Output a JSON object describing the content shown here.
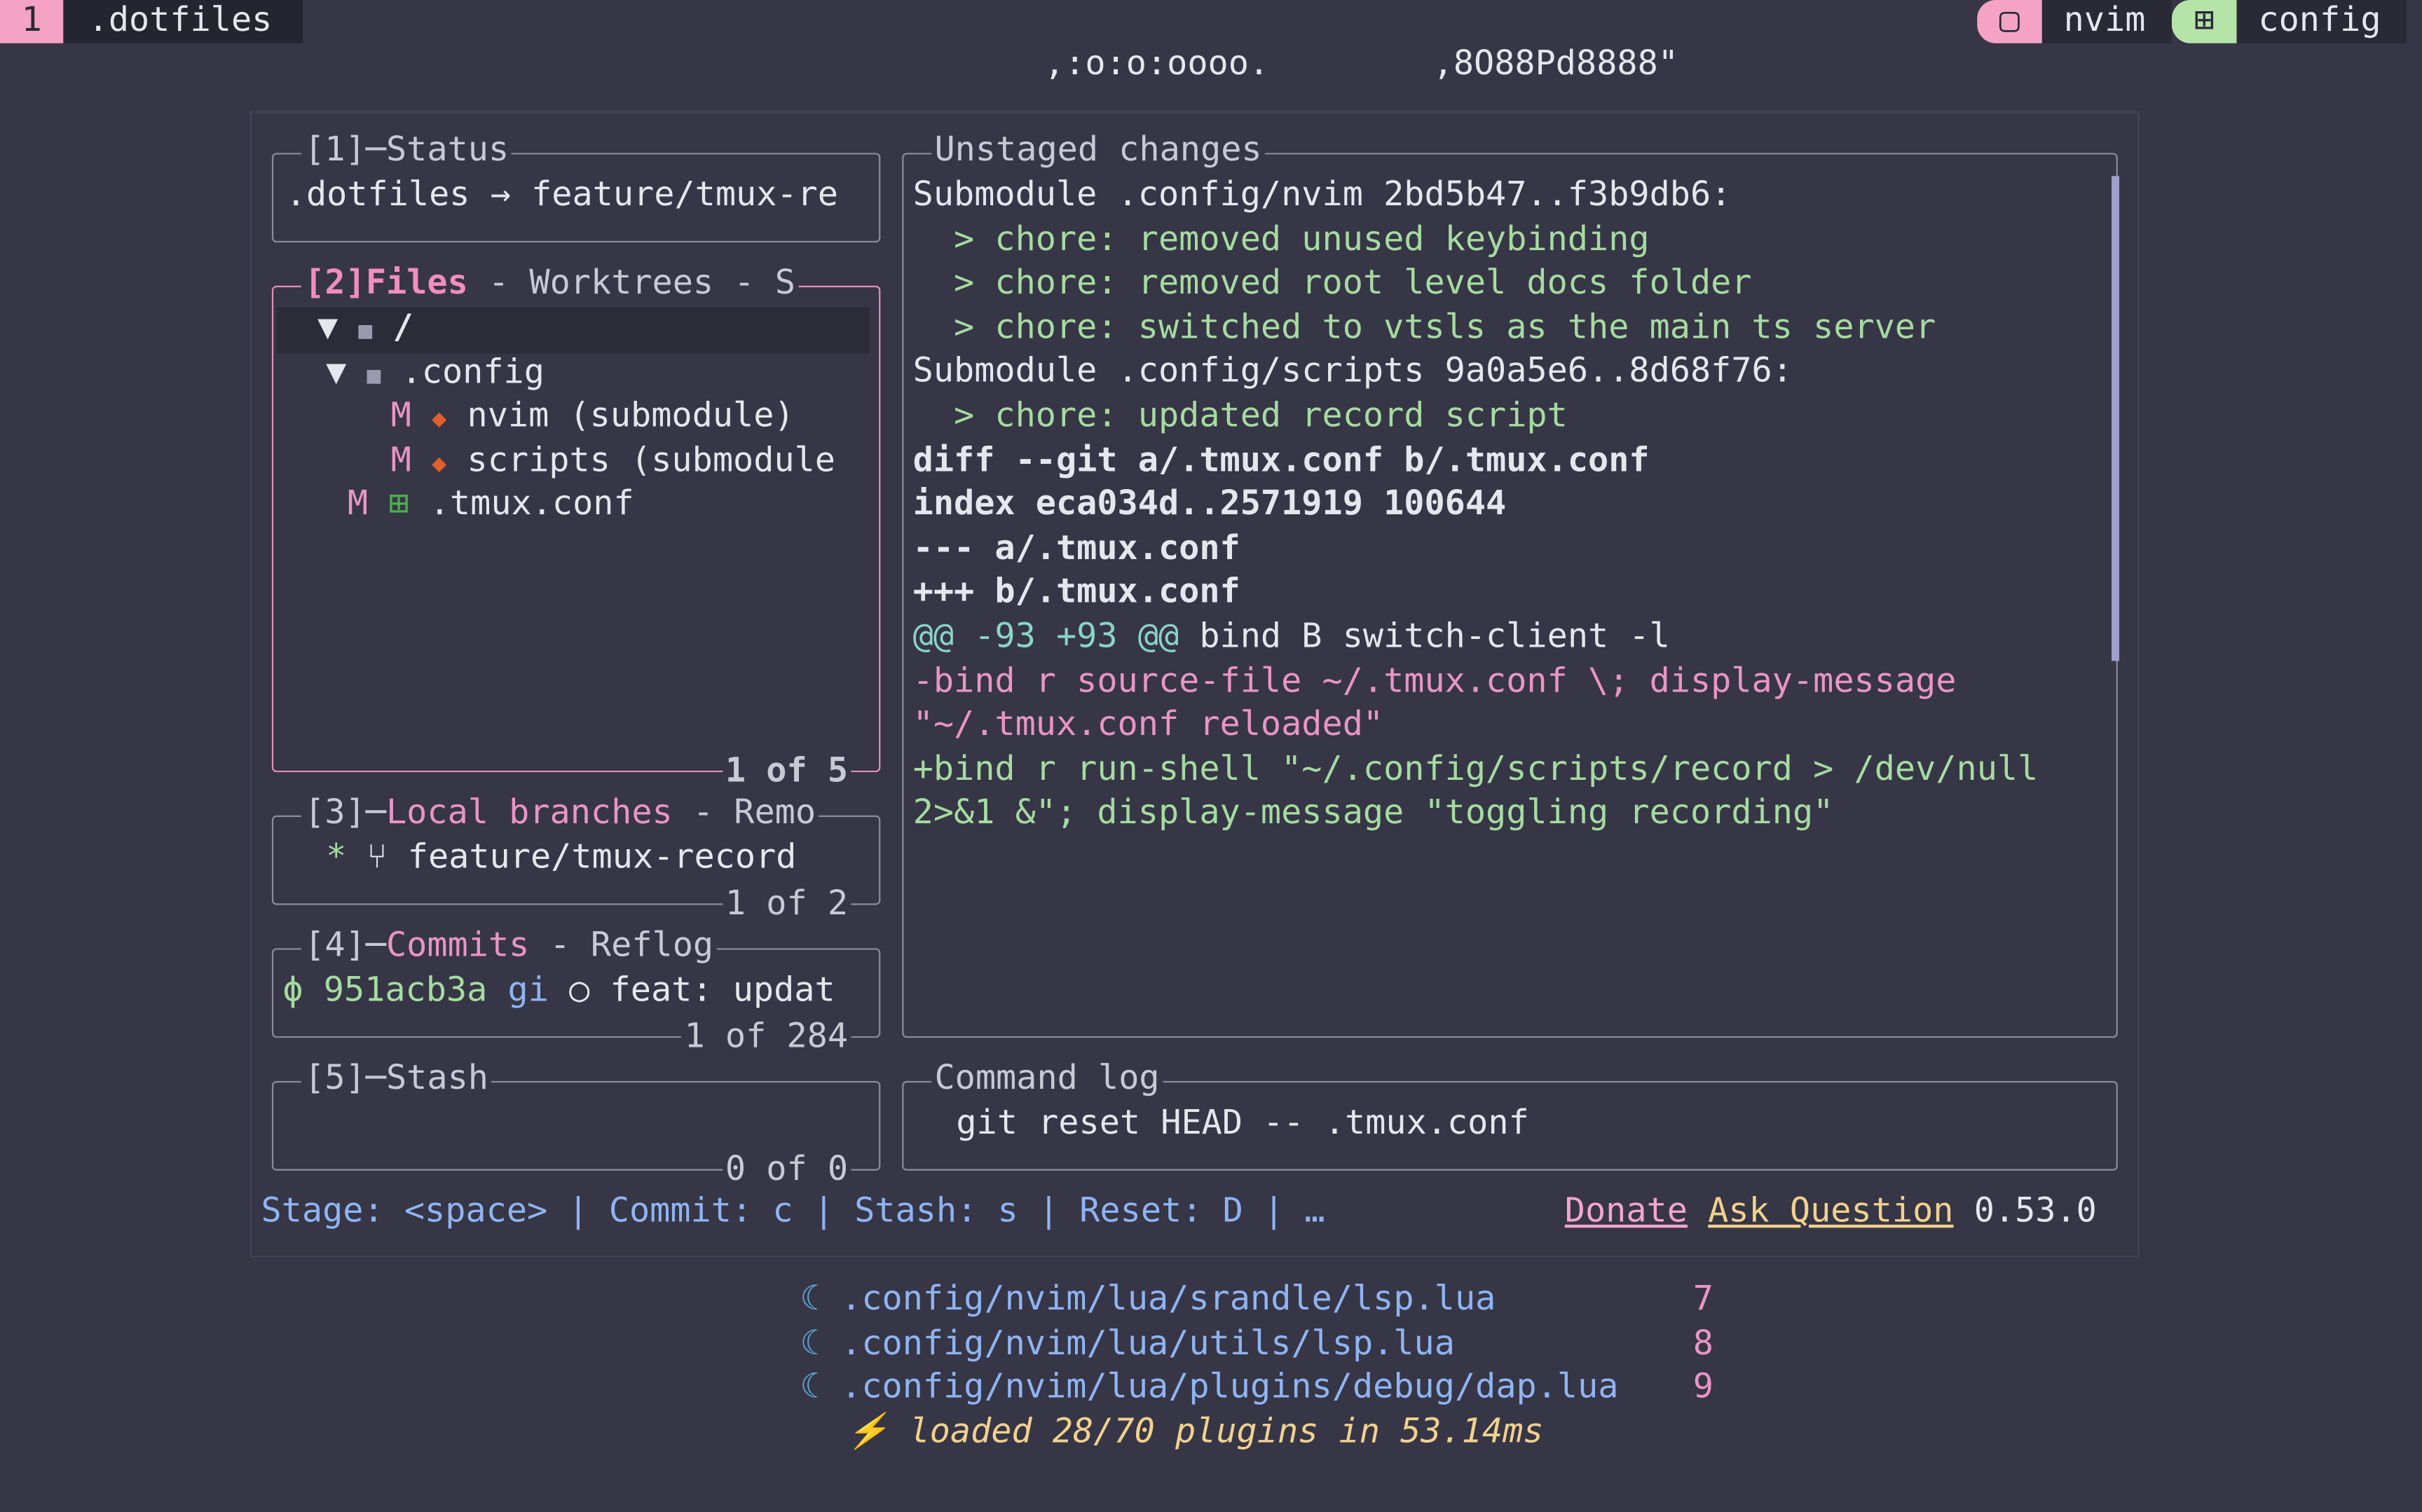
{
  "tmux": {
    "window_index": "1",
    "window_name": ".dotfiles",
    "right_tabs": [
      {
        "icon": "▢",
        "label": "nvim",
        "color": "#f4a3c4"
      },
      {
        "icon": "⊞",
        "label": "config",
        "color": "#b5e3a8"
      }
    ]
  },
  "ascii_art": ",:o:o:oooo.        ,8O88Pd8888\"",
  "status_panel": {
    "title": "[1]─Status",
    "repo": ".dotfiles → feature/tmux-re"
  },
  "files_panel": {
    "title_index": "[2]",
    "title_active": "Files",
    "title_rest": " - Worktrees - S",
    "footer": "1 of 5",
    "tree": [
      {
        "arrow": "▼",
        "icon": "■",
        "name": "/"
      },
      {
        "arrow": "▼",
        "icon": "■",
        "name": ".config"
      },
      {
        "status": "M",
        "icon": "◆",
        "name": "nvim (submodule)"
      },
      {
        "status": "M",
        "icon": "◆",
        "name": "scripts (submodule"
      },
      {
        "status": "M",
        "icon": "⊞",
        "name": ".tmux.conf"
      }
    ]
  },
  "branches_panel": {
    "title_index": "[3]─",
    "title_active": "Local branches",
    "title_rest": " - Remo",
    "branch_marker": "*",
    "branch_icon": "⑂",
    "branch": "feature/tmux-record",
    "footer": "1 of 2"
  },
  "commits_panel": {
    "title_index": "[4]─",
    "title_active": "Commits",
    "title_rest": " - Reflog",
    "commit_icon": "ϕ",
    "hash": "951acb3a",
    "author": "gi",
    "dot": "○",
    "message": "feat: updat",
    "footer": "1 of 284"
  },
  "stash_panel": {
    "title": "[5]─Stash",
    "footer": "0 of 0"
  },
  "diff_panel": {
    "title": "Unstaged changes",
    "lines": [
      {
        "text": "Submodule .config/nvim 2bd5b47..f3b9db6:",
        "style": "normal"
      },
      {
        "text": "  > chore: removed unused keybinding",
        "style": "green"
      },
      {
        "text": "  > chore: removed root level docs folder",
        "style": "green"
      },
      {
        "text": "  > chore: switched to vtsls as the main ts server",
        "style": "green"
      },
      {
        "text": "Submodule .config/scripts 9a0a5e6..8d68f76:",
        "style": "normal"
      },
      {
        "text": "  > chore: updated record script",
        "style": "green"
      },
      {
        "text": "diff --git a/.tmux.conf b/.tmux.conf",
        "style": "bold"
      },
      {
        "text": "index eca034d..2571919 100644",
        "style": "bold"
      },
      {
        "text": "--- a/.tmux.conf",
        "style": "bold"
      },
      {
        "text": "+++ b/.tmux.conf",
        "style": "bold"
      },
      {
        "text_hunk": "@@ -93 +93 @@",
        "text_rest": " bind B switch-client -l",
        "style": "hunk"
      },
      {
        "text": "-bind r source-file ~/.tmux.conf \\; display-message",
        "style": "pink"
      },
      {
        "text": "\"~/.tmux.conf reloaded\"",
        "style": "pink"
      },
      {
        "text": "+bind r run-shell \"~/.config/scripts/record > /dev/null",
        "style": "green"
      },
      {
        "text": "2>&1 &\"; display-message \"toggling recording\"",
        "style": "green"
      }
    ]
  },
  "command_log": {
    "title": "Command log",
    "entry": "git reset HEAD -- .tmux.conf"
  },
  "keybar": {
    "hints": "Stage: <space> | Commit: c | Stash: s | Reset: D | …",
    "donate": "Donate",
    "ask": "Ask Question",
    "version": "0.53.0"
  },
  "nvim_recent": [
    {
      "icon": "☾",
      "path": ".config/nvim/lua/srandle/lsp.lua",
      "num": "7"
    },
    {
      "icon": "☾",
      "path": ".config/nvim/lua/utils/lsp.lua",
      "num": "8"
    },
    {
      "icon": "☾",
      "path": ".config/nvim/lua/plugins/debug/dap.lua",
      "num": "9"
    }
  ],
  "lazy_stats": {
    "icon": "⚡",
    "text": "loaded 28/70 plugins in 53.14ms"
  },
  "colors": {
    "background": "#363646",
    "accent_pink": "#e995c5",
    "accent_green": "#a6dba0",
    "accent_blue": "#8fb4f2"
  }
}
